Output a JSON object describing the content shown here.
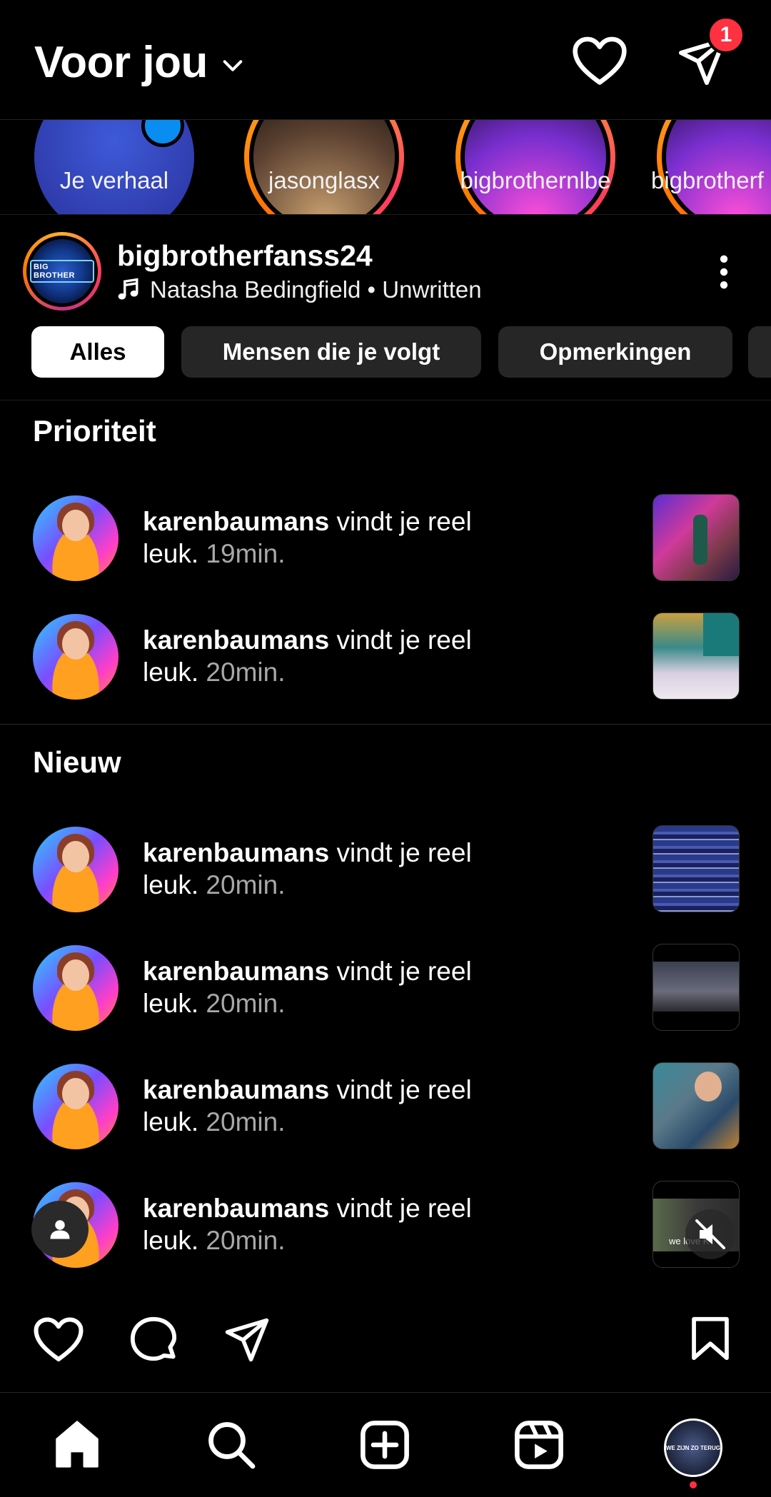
{
  "header": {
    "title": "Voor jou",
    "notification_badge": "1"
  },
  "stories": [
    {
      "label": "Je verhaal"
    },
    {
      "label": "jasonglasx"
    },
    {
      "label": "bigbrothernlbe"
    },
    {
      "label": "bigbrotherf"
    }
  ],
  "post": {
    "username": "bigbrotherfanss24",
    "music": "Natasha Bedingfield • Unwritten",
    "logo_text": "BIG BROTHER"
  },
  "filters": [
    {
      "label": "Alles",
      "active": true
    },
    {
      "label": "Mensen die je volgt",
      "active": false
    },
    {
      "label": "Opmerkingen",
      "active": false
    }
  ],
  "sections": {
    "priority": {
      "title": "Prioriteit",
      "items": [
        {
          "user": "karenbaumans",
          "action": " vindt je reel leuk.",
          "time": " 19min."
        },
        {
          "user": "karenbaumans",
          "action": " vindt je reel leuk.",
          "time": " 20min."
        }
      ]
    },
    "new": {
      "title": "Nieuw",
      "items": [
        {
          "user": "karenbaumans",
          "action": " vindt je reel leuk.",
          "time": " 20min."
        },
        {
          "user": "karenbaumans",
          "action": " vindt je reel leuk.",
          "time": " 20min."
        },
        {
          "user": "karenbaumans",
          "action": " vindt je reel leuk.",
          "time": " 20min."
        },
        {
          "user": "karenbaumans",
          "action": " vindt je reel leuk.",
          "time": " 20min."
        }
      ]
    }
  },
  "thumb_captions": {
    "last": "we love K"
  },
  "profile_avatar_text": "WE ZIJN ZO TERUG",
  "colors": {
    "background": "#000000",
    "badge": "#ff3040",
    "chip": "#262626",
    "muted_text": "#a8a8a8",
    "story_plus": "#0a8df0"
  },
  "icons": {
    "header": [
      "heart-icon",
      "send-icon"
    ],
    "actions": [
      "heart-icon",
      "comment-icon",
      "share-icon",
      "bookmark-icon"
    ],
    "nav": [
      "home-icon",
      "search-icon",
      "create-icon",
      "reels-icon",
      "profile-avatar"
    ]
  }
}
